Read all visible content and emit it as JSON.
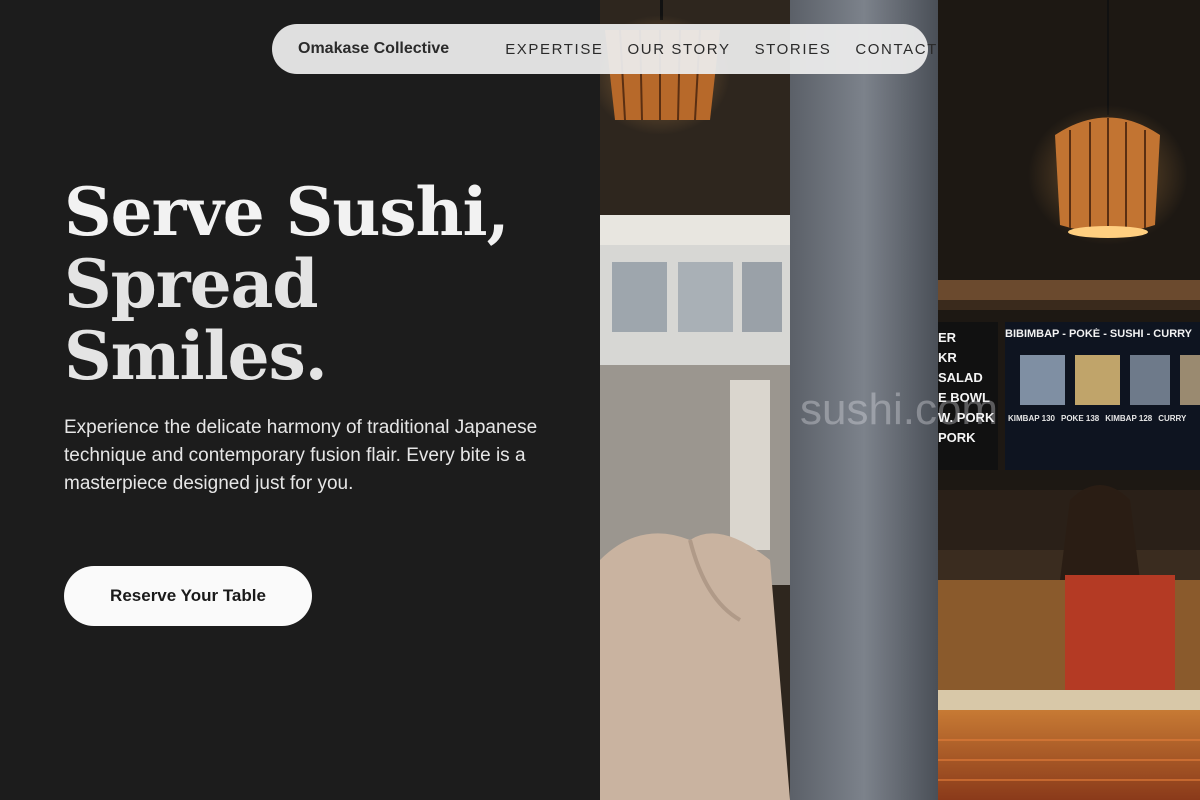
{
  "nav": {
    "brand": "Omakase Collective",
    "links": [
      "EXPERTISE",
      "OUR STORY",
      "STORIES",
      "CONTACT"
    ]
  },
  "hero": {
    "headline": [
      "Serve Sushi,",
      "Spread",
      "Smiles."
    ],
    "subtext": "Experience the delicate harmony of traditional Japanese technique and contemporary fusion flair. Every bite is a masterpiece designed just for you.",
    "cta_label": "Reserve Your Table"
  },
  "photo": {
    "menu_header": "BIBIMBAP - POKÉ - SUSHI - CURRY",
    "menu_left": [
      "ER",
      "KR",
      "SALAD",
      "E BOWL",
      "W. PORK",
      "PORK"
    ],
    "menu_items": [
      "KIMBAP 130",
      "POKE 138",
      "KIMBAP 128",
      "CURRY"
    ],
    "watermark": "sushi.com"
  },
  "colors": {
    "panel_bg": "#1c1c1c",
    "nav_bg": "#ececec",
    "button_bg": "#fafafa",
    "lamp_glow": "#e39a44"
  }
}
